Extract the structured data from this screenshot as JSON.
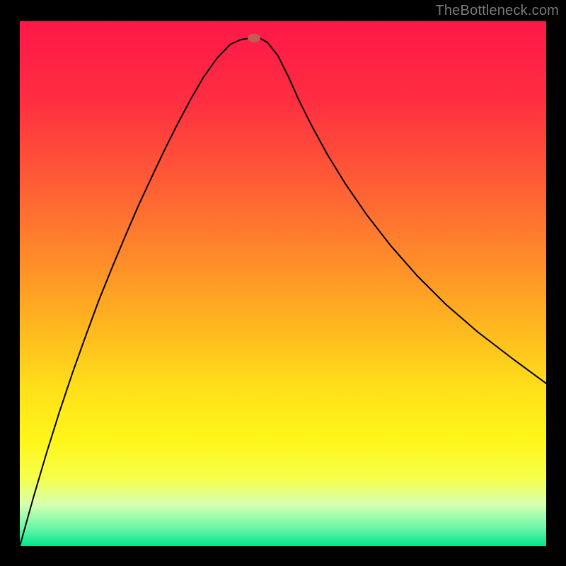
{
  "watermark": "TheBottleneck.com",
  "marker": {
    "color": "#c85a54",
    "cx": 0.445,
    "cy": 0.968
  },
  "chart_data": {
    "type": "line",
    "title": "",
    "xlabel": "",
    "ylabel": "",
    "xlim": [
      0,
      1
    ],
    "ylim": [
      0,
      1
    ],
    "background_gradient": {
      "stops": [
        {
          "offset": 0.0,
          "color": "#ff1748"
        },
        {
          "offset": 0.15,
          "color": "#ff2e41"
        },
        {
          "offset": 0.3,
          "color": "#ff5a36"
        },
        {
          "offset": 0.45,
          "color": "#ff8a2a"
        },
        {
          "offset": 0.58,
          "color": "#ffb61f"
        },
        {
          "offset": 0.7,
          "color": "#ffe01a"
        },
        {
          "offset": 0.8,
          "color": "#fff61a"
        },
        {
          "offset": 0.87,
          "color": "#f6ff4a"
        },
        {
          "offset": 0.92,
          "color": "#d8ffb0"
        },
        {
          "offset": 0.965,
          "color": "#6cf7a8"
        },
        {
          "offset": 1.0,
          "color": "#00e58a"
        }
      ]
    },
    "series": [
      {
        "name": "bottleneck-curve",
        "color": "#000000",
        "stroke_width": 2,
        "x": [
          0.0,
          0.025,
          0.05,
          0.075,
          0.1,
          0.125,
          0.15,
          0.175,
          0.2,
          0.225,
          0.25,
          0.275,
          0.3,
          0.325,
          0.35,
          0.375,
          0.4,
          0.42,
          0.438,
          0.455,
          0.47,
          0.49,
          0.51,
          0.53,
          0.555,
          0.585,
          0.62,
          0.66,
          0.705,
          0.755,
          0.81,
          0.87,
          0.935,
          1.0
        ],
        "y": [
          0.0,
          0.09,
          0.175,
          0.255,
          0.33,
          0.4,
          0.468,
          0.53,
          0.59,
          0.648,
          0.702,
          0.755,
          0.805,
          0.852,
          0.895,
          0.93,
          0.956,
          0.965,
          0.968,
          0.968,
          0.96,
          0.935,
          0.895,
          0.85,
          0.8,
          0.745,
          0.688,
          0.63,
          0.572,
          0.515,
          0.46,
          0.408,
          0.358,
          0.31
        ]
      }
    ]
  }
}
